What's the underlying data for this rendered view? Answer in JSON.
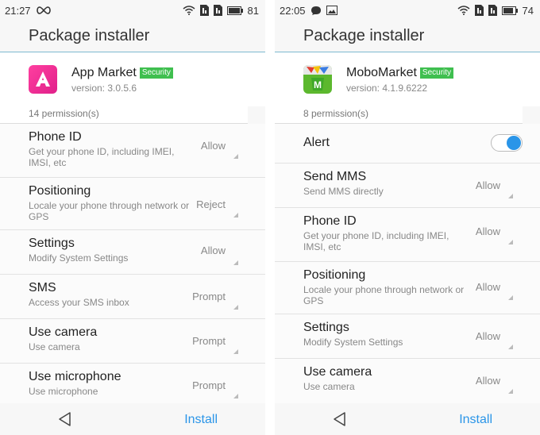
{
  "left": {
    "status": {
      "time": "21:27",
      "battery": "81"
    },
    "title": "Package installer",
    "app": {
      "name": "App Market",
      "badge": "Security",
      "version": "version: 3.0.5.6"
    },
    "perm_count": "14 permission(s)",
    "permissions": [
      {
        "name": "Phone ID",
        "desc": "Get your phone ID, including IMEI, IMSI, etc",
        "value": "Allow"
      },
      {
        "name": "Positioning",
        "desc": "Locale your phone through network or GPS",
        "value": "Reject"
      },
      {
        "name": "Settings",
        "desc": "Modify System Settings",
        "value": "Allow"
      },
      {
        "name": "SMS",
        "desc": "Access your SMS inbox",
        "value": "Prompt"
      },
      {
        "name": "Use camera",
        "desc": "Use camera",
        "value": "Prompt"
      },
      {
        "name": "Use microphone",
        "desc": "Use microphone",
        "value": "Prompt"
      }
    ],
    "install_label": "Install"
  },
  "right": {
    "status": {
      "time": "22:05",
      "battery": "74"
    },
    "title": "Package installer",
    "app": {
      "name": "MoboMarket",
      "badge": "Security",
      "version": "version: 4.1.9.6222"
    },
    "perm_count": "8 permission(s)",
    "alert_label": "Alert",
    "permissions": [
      {
        "name": "Send MMS",
        "desc": "Send MMS directly",
        "value": "Allow"
      },
      {
        "name": "Phone ID",
        "desc": "Get your phone ID, including IMEI, IMSI, etc",
        "value": "Allow"
      },
      {
        "name": "Positioning",
        "desc": "Locale your phone through network or GPS",
        "value": "Allow"
      },
      {
        "name": "Settings",
        "desc": "Modify System Settings",
        "value": "Allow"
      },
      {
        "name": "Use camera",
        "desc": "Use camera",
        "value": "Allow"
      }
    ],
    "install_label": "Install"
  },
  "colors": {
    "accent": "#2a95e8",
    "badge": "#3fbf4f",
    "divider": "#7db9cf"
  }
}
